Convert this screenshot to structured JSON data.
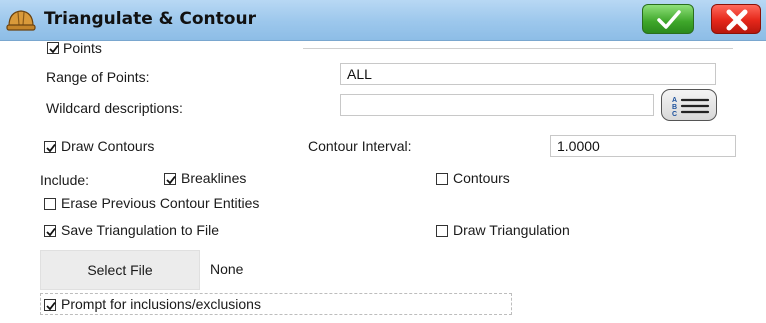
{
  "window": {
    "title": "Triangulate & Contour",
    "icon": "hardhat-icon",
    "ok_icon": "checkmark-icon",
    "cancel_icon": "close-x-icon"
  },
  "points_group": {
    "checkbox_label": "Points",
    "checked": true,
    "range_label": "Range of Points:",
    "range_value": "ALL",
    "wildcard_label": "Wildcard descriptions:",
    "wildcard_value": "",
    "list_button_icon": "abc-list-icon"
  },
  "draw_contours": {
    "label": "Draw Contours",
    "checked": true
  },
  "contour_interval": {
    "label": "Contour Interval:",
    "value": "1.0000"
  },
  "include": {
    "label": "Include:",
    "breaklines": {
      "label": "Breaklines",
      "checked": true
    },
    "contours": {
      "label": "Contours",
      "checked": false
    }
  },
  "erase_previous": {
    "label": "Erase Previous Contour Entities",
    "checked": false
  },
  "save_triangulation": {
    "label": "Save Triangulation to File",
    "checked": true
  },
  "draw_triangulation": {
    "label": "Draw Triangulation",
    "checked": false
  },
  "file": {
    "select_button": "Select File",
    "current": "None"
  },
  "prompt_inclusions": {
    "label": "Prompt for inclusions/exclusions",
    "checked": true
  },
  "colors": {
    "titlebar": "#9cc7ec",
    "ok_green": "#3ea62a",
    "cancel_red": "#e5271a"
  }
}
